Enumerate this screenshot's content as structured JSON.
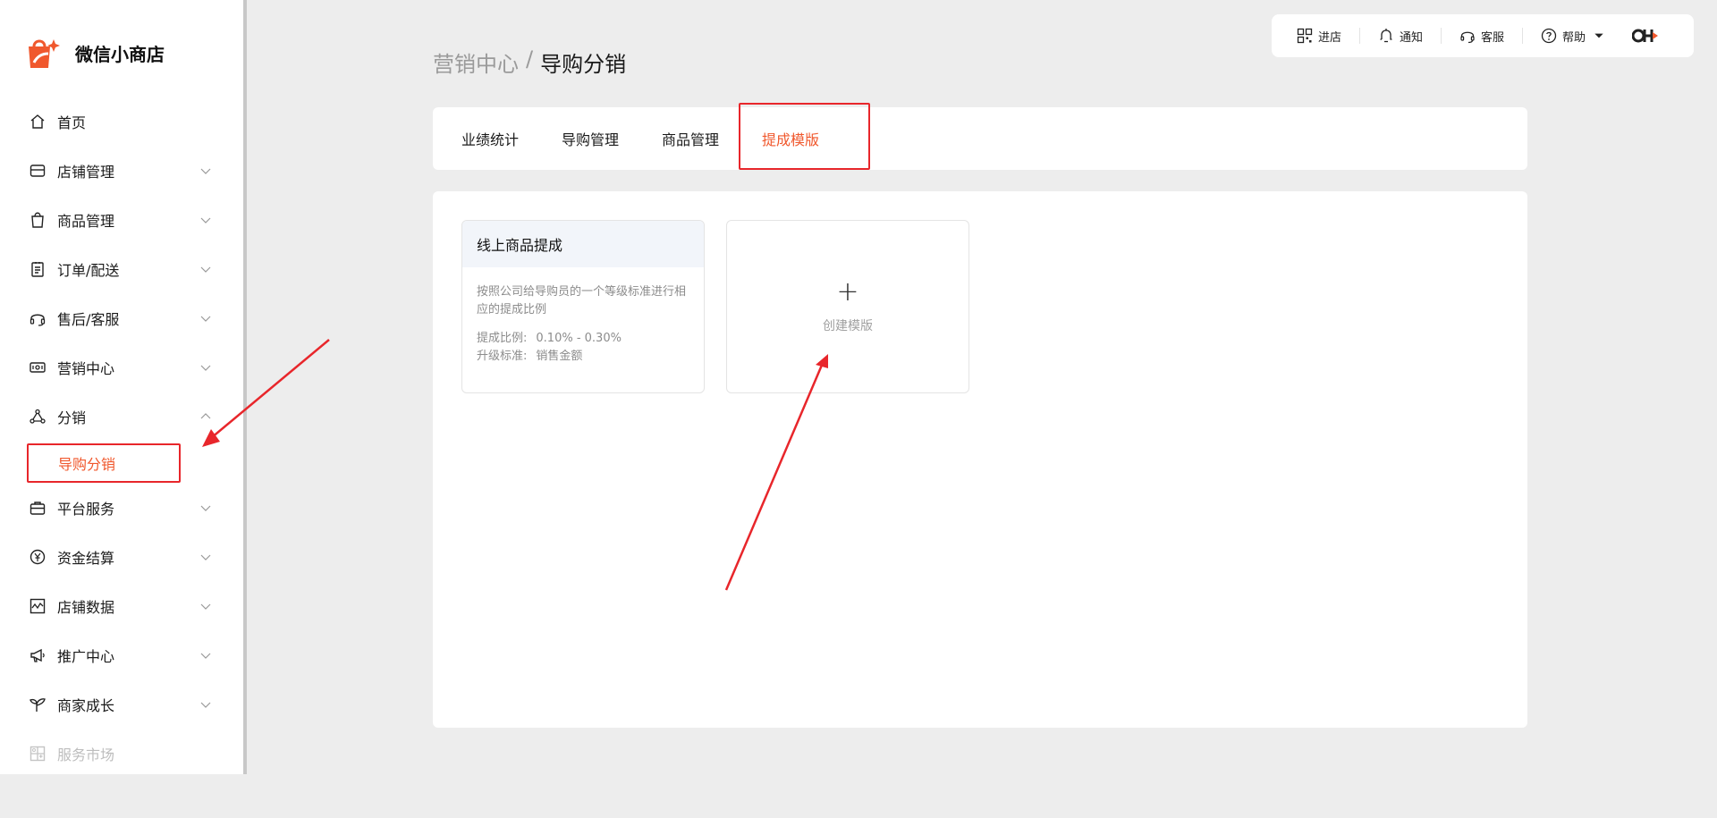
{
  "app": {
    "name": "微信小商店"
  },
  "sidebar": {
    "items": [
      {
        "label": "首页",
        "icon": "home-icon"
      },
      {
        "label": "店铺管理",
        "icon": "store-icon"
      },
      {
        "label": "商品管理",
        "icon": "bag-icon"
      },
      {
        "label": "订单/配送",
        "icon": "clipboard-icon"
      },
      {
        "label": "售后/客服",
        "icon": "headset-icon"
      },
      {
        "label": "营销中心",
        "icon": "ticket-icon"
      },
      {
        "label": "分销",
        "icon": "share-nodes-icon",
        "expanded": true
      },
      {
        "label": "平台服务",
        "icon": "briefcase-icon"
      },
      {
        "label": "资金结算",
        "icon": "yen-icon"
      },
      {
        "label": "店铺数据",
        "icon": "chart-icon"
      },
      {
        "label": "推广中心",
        "icon": "megaphone-icon"
      },
      {
        "label": "商家成长",
        "icon": "sprout-icon"
      },
      {
        "label": "服务市场",
        "icon": "grid-icon",
        "disabled": true
      }
    ],
    "sub_item": {
      "label": "导购分销",
      "active": true
    }
  },
  "topbar": {
    "store": "进店",
    "notify": "通知",
    "service": "客服",
    "help": "帮助"
  },
  "breadcrumb": {
    "parent": "营销中心",
    "separator": "/",
    "current": "导购分销"
  },
  "tabs": [
    {
      "label": "业绩统计"
    },
    {
      "label": "导购管理"
    },
    {
      "label": "商品管理"
    },
    {
      "label": "提成模版",
      "active": true
    }
  ],
  "template_card": {
    "title": "线上商品提成",
    "description": "按照公司给导购员的一个等级标准进行相应的提成比例",
    "ratio_label": "提成比例:",
    "ratio_value": "0.10% - 0.30%",
    "standard_label": "升级标准:",
    "standard_value": "销售金额"
  },
  "create_card": {
    "plus": "+",
    "label": "创建模版"
  },
  "colors": {
    "accent": "#f0582d",
    "annotation": "#e8262b",
    "background": "#ededed"
  }
}
